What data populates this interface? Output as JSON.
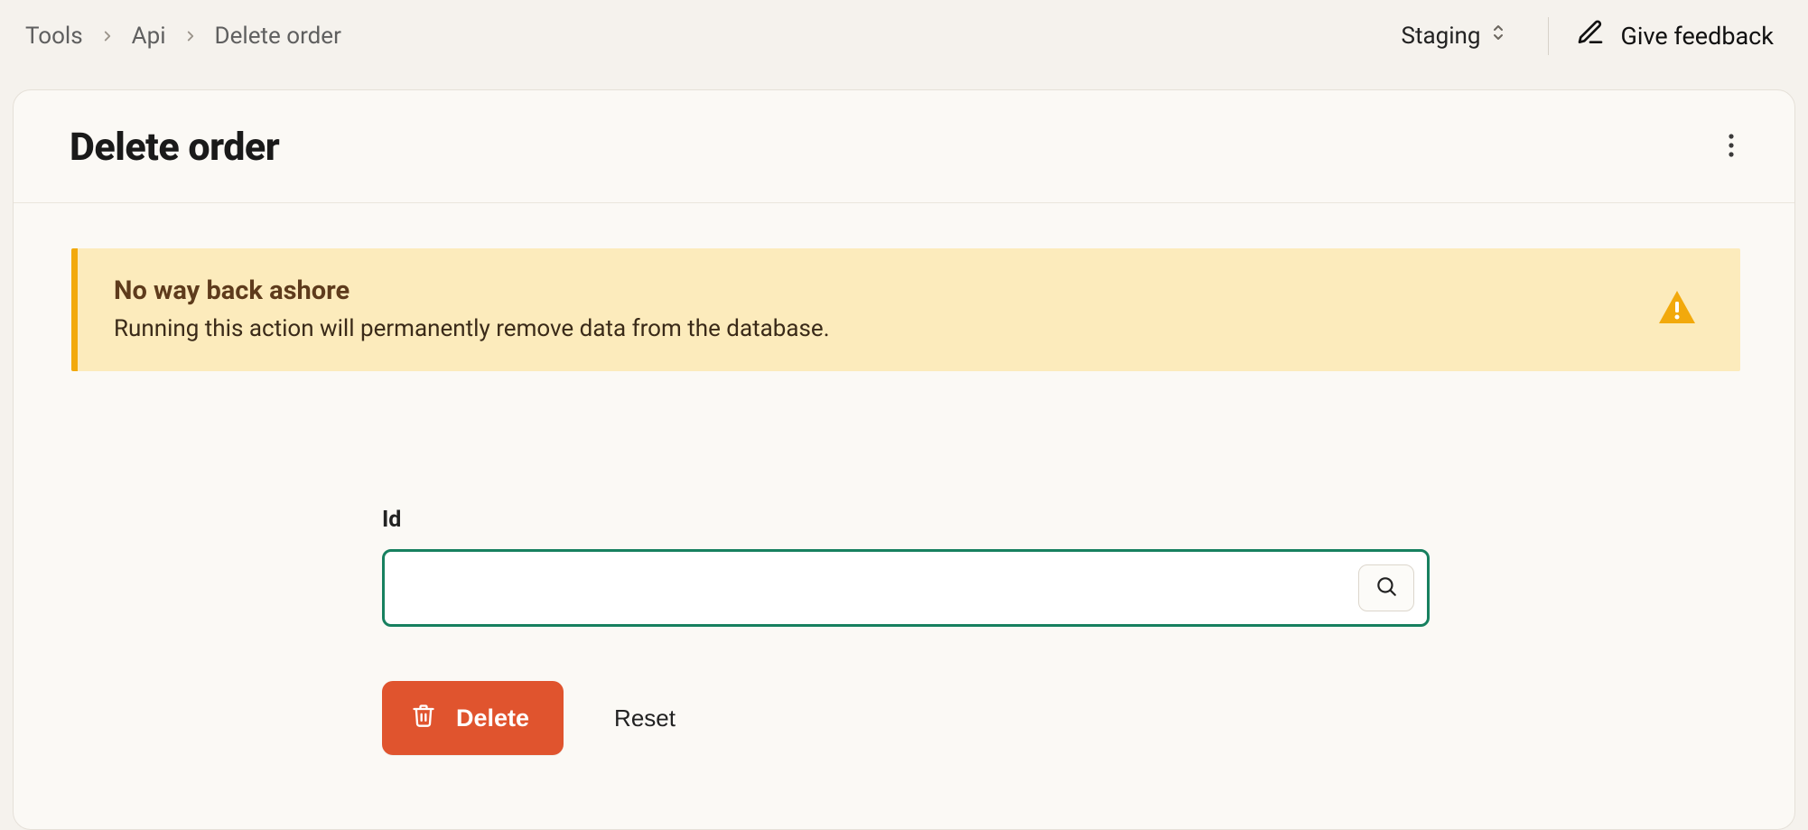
{
  "breadcrumbs": {
    "tools": "Tools",
    "api": "Api",
    "current": "Delete order"
  },
  "header": {
    "environment": "Staging",
    "feedback_label": "Give feedback"
  },
  "page": {
    "title": "Delete order"
  },
  "banner": {
    "title": "No way back ashore",
    "description": "Running this action will permanently remove data from the database."
  },
  "form": {
    "id_label": "Id",
    "id_value": "",
    "delete_label": "Delete",
    "reset_label": "Reset"
  },
  "colors": {
    "accent_green": "#17805f",
    "danger": "#e0542e",
    "warning_bg": "#fcebbc",
    "warning_border": "#f2a90c"
  }
}
